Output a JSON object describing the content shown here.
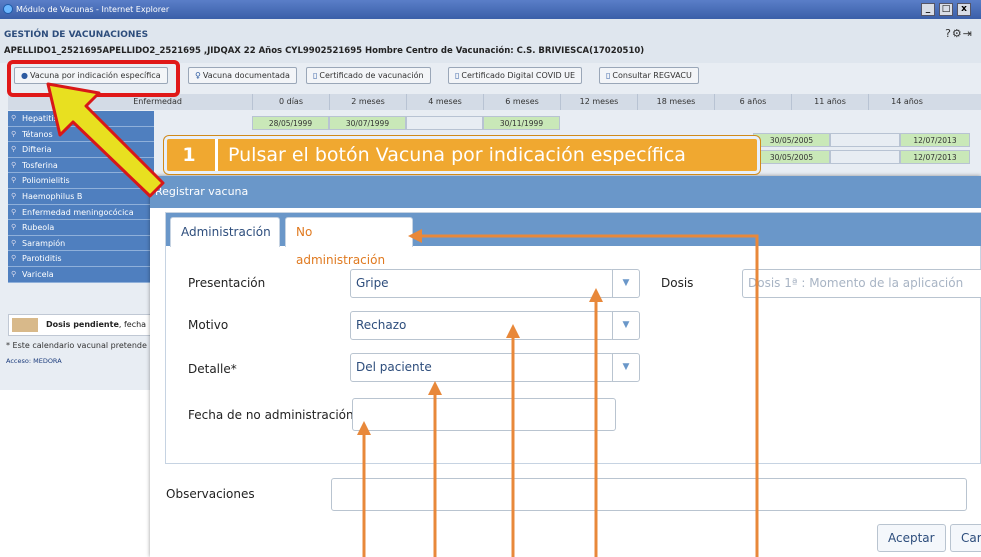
{
  "window": {
    "title": "Módulo de Vacunas - Internet Explorer",
    "controls": [
      "_",
      "□",
      "x"
    ]
  },
  "app": {
    "title": "GESTIÓN DE VACUNACIONES",
    "patient_info": "APELLIDO1_2521695APELLIDO2_2521695 ,JIDQAX   22 Años   CYL9902521695   Hombre   Centro de Vacunación: C.S. BRIVIESCA(17020510)",
    "header_icons": "?⚙⇥"
  },
  "toolbar": {
    "vacuna_indicacion": "Vacuna por indicación específica",
    "vacuna_documentada": "Vacuna documentada",
    "certificado_vacunacion": "Certificado de vacunación",
    "certificado_covid": "Certificado Digital COVID UE",
    "consultar_regvacu": "Consultar REGVACU"
  },
  "table": {
    "disease_header": "Enfermedad",
    "columns": [
      "0 días",
      "2 meses",
      "4 meses",
      "6 meses",
      "12 meses",
      "18 meses",
      "6 años",
      "11 años",
      "14 años"
    ],
    "diseases": [
      "Hepatitis B",
      "Tétanos",
      "Difteria",
      "Tosferina",
      "Poliomielitis",
      "Haemophilus B",
      "Enfermedad meningocócica",
      "Rubeola",
      "Sarampión",
      "Parotiditis",
      "Varicela"
    ],
    "row0": [
      "28/05/1999",
      "30/07/1999",
      "",
      "30/11/1999"
    ],
    "row1_tail": [
      "30/05/2005",
      "",
      "12/07/2013"
    ],
    "row2_tail": [
      "30/05/2005",
      "",
      "12/07/2013"
    ]
  },
  "legend": {
    "bold": "Dosis pendiente",
    "rest": ", fecha"
  },
  "footnote": "* Este calendario vacunal pretende",
  "access": "Acceso: MEDORA",
  "callout": {
    "number": "1",
    "text": "Pulsar el botón Vacuna por indicación específica"
  },
  "modal": {
    "title": "Registrar vacuna",
    "tabs": [
      "Administración",
      "No administración"
    ],
    "presentacion_label": "Presentación",
    "presentacion_value": "Gripe",
    "dosis_label": "Dosis",
    "dosis_placeholder": "Dosis 1ª : Momento de la aplicación",
    "motivo_label": "Motivo",
    "motivo_value": "Rechazo",
    "detalle_label": "Detalle*",
    "detalle_value": "Del paciente",
    "fecha_label": "Fecha de no administración",
    "fecha_value": "",
    "observaciones_label": "Observaciones",
    "observaciones_value": "",
    "aceptar": "Aceptar",
    "cancelar": "Car"
  },
  "colors": {
    "highlight_red": "#e01818",
    "callout_orange": "#f0a830",
    "arrow_orange": "#e8883a",
    "modal_blue": "#6a97c9",
    "active_tab_orange": "#e07a20"
  }
}
